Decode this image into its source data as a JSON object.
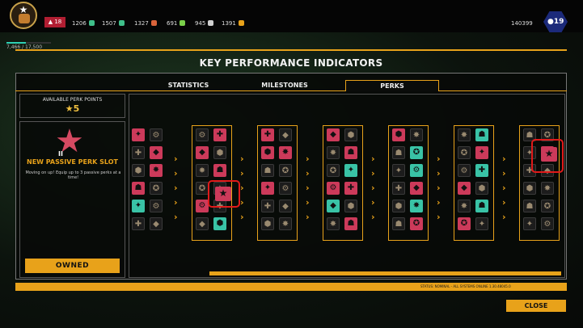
{
  "player": {
    "level": "18",
    "xp_text": "7,466 / 17,500",
    "xp_progress": 0.43
  },
  "resources": [
    {
      "value": "1206",
      "color": "#3fbf8a",
      "icon": "ammo-icon"
    },
    {
      "value": "1507",
      "color": "#3fbf8a",
      "icon": "crystal-icon"
    },
    {
      "value": "1327",
      "color": "#d9633a",
      "icon": "fire-icon"
    },
    {
      "value": "691",
      "color": "#7ad04a",
      "icon": "leaf-icon"
    },
    {
      "value": "945",
      "color": "#d0d0d0",
      "icon": "gear-icon"
    },
    {
      "value": "1391",
      "color": "#e8a21a",
      "icon": "coin-icon"
    }
  ],
  "currency": "140399",
  "hex_badge": "19",
  "title": "KEY PERFORMANCE INDICATORS",
  "tabs": [
    {
      "label": "STATISTICS",
      "active": false
    },
    {
      "label": "MILESTONES",
      "active": false
    },
    {
      "label": "PERKS",
      "active": true
    }
  ],
  "available_points": {
    "label": "AVAILABLE PERK POINTS",
    "value": "5"
  },
  "selected_perk": {
    "numeral": "II",
    "title": "NEW PASSIVE PERK SLOT",
    "description": "Moving on up! Equip up to 3 passive perks at a time!",
    "button": "OWNED"
  },
  "status_text": "STATUS: NOMINAL - ALL SYSTEMS ONLINE 1.30.48045.0",
  "close_label": "CLOSE",
  "colors": {
    "accent": "#e8a21a",
    "perk_red": "#cc3a5a",
    "perk_teal": "#39c3a6",
    "highlight": "#e01a1a"
  }
}
